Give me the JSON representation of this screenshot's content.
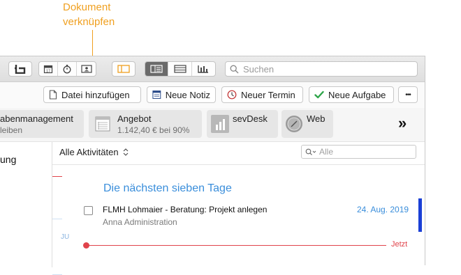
{
  "annotation": {
    "line1": "Dokument",
    "line2": "verknüpfen"
  },
  "toolbar": {
    "search_placeholder": "Suchen"
  },
  "actions": {
    "add_file": "Datei hinzufügen",
    "new_note": "Neue Notiz",
    "new_appointment": "Neuer Termin",
    "new_task": "Neue Aufgabe",
    "more": "•••"
  },
  "quick_links": [
    {
      "title": "abenmanagement",
      "subtitle": "leiben"
    },
    {
      "title": "Angebot",
      "subtitle": "1.142,40 € bei 90%"
    },
    {
      "title": "sevDesk"
    },
    {
      "title": "Web"
    }
  ],
  "overflow": "»",
  "sidebar": {
    "item": "ung"
  },
  "activities": {
    "filter_label": "Alle Aktivitäten",
    "filter_placeholder": "Alle",
    "section_title": "Die nächsten sieben Tage",
    "task_title": "FLMH Lohmaier - Beratung: Projekt anlegen",
    "task_subtitle": "Anna Administration",
    "task_date": "24. Aug. 2019",
    "month_label": "JU",
    "now_label": "Jetzt"
  },
  "colors": {
    "annotation": "#F0A020",
    "link": "#3A8EDB",
    "now": "#E0434B",
    "accent_bar": "#1A3FD6"
  }
}
